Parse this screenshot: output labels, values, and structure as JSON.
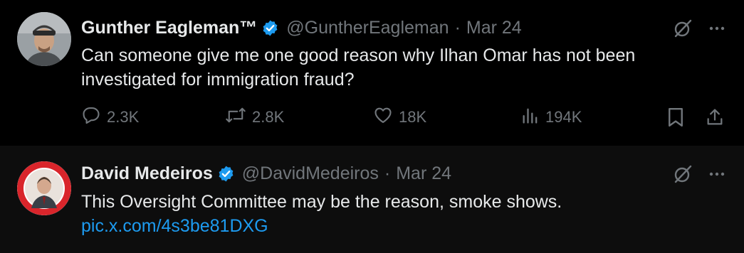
{
  "tweets": [
    {
      "name": "Gunther Eagleman™",
      "handle": "@GuntherEagleman",
      "separator": "·",
      "date": "Mar 24",
      "text": "Can someone give me one good reason why Ilhan Omar has not been investigated for immigration fraud?",
      "stats": {
        "replies": "2.3K",
        "reposts": "2.8K",
        "likes": "18K",
        "views": "194K"
      }
    },
    {
      "name": "David Medeiros",
      "handle": "@DavidMedeiros",
      "separator": "·",
      "date": "Mar 24",
      "text": "This Oversight Committee may be the reason, smoke shows.",
      "link": "pic.x.com/4s3be81DXG"
    }
  ],
  "icons": {
    "verified": "verified-badge-icon",
    "grok": "grok-icon",
    "more": "more-icon",
    "reply": "reply-icon",
    "repost": "repost-icon",
    "like": "like-icon",
    "views": "views-icon",
    "bookmark": "bookmark-icon",
    "share": "share-icon"
  },
  "colors": {
    "background": "#000000",
    "reply_background": "#0d0d0d",
    "text": "#e7e9ea",
    "muted": "#71767b",
    "accent": "#1d9bf0",
    "logo_red": "#d9252b"
  }
}
